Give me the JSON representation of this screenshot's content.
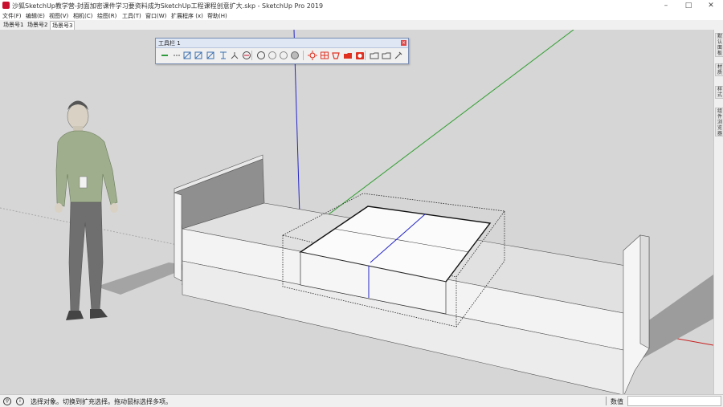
{
  "window": {
    "title": "沙狐SketchUp教学营-封面加密课件学习要资料成为SketchUp工程课程创意扩大.skp - SketchUp Pro 2019",
    "minimize_glyph": "–",
    "maximize_glyph": "□",
    "close_glyph": "✕"
  },
  "menu": [
    {
      "label": "文件(F)"
    },
    {
      "label": "编辑(E)"
    },
    {
      "label": "视图(V)"
    },
    {
      "label": "相机(C)"
    },
    {
      "label": "绘图(R)"
    },
    {
      "label": "工具(T)"
    },
    {
      "label": "窗口(W)"
    },
    {
      "label": "扩展程序 (x)"
    },
    {
      "label": "帮助(H)"
    }
  ],
  "scenes": [
    {
      "label": "场景号1",
      "active": false
    },
    {
      "label": "场景号2",
      "active": false
    },
    {
      "label": "场景号3",
      "active": true
    }
  ],
  "toolbar": {
    "title": "工具栏 1",
    "close_glyph": "×",
    "buttons": [
      {
        "icon": "select-icon",
        "color": "#2e9b3c"
      },
      {
        "icon": "dashes-icon",
        "color": "#555555"
      },
      {
        "icon": "iso-view-icon",
        "color": "#3a6fb0"
      },
      {
        "icon": "top-view-icon",
        "color": "#3a6fb0"
      },
      {
        "icon": "front-view-icon",
        "color": "#3a6fb0"
      },
      {
        "icon": "align-icon",
        "color": "#3a6fb0"
      },
      {
        "icon": "axes-icon",
        "color": "#555555"
      },
      {
        "icon": "section-icon",
        "color": "#c8102e"
      },
      {
        "icon": "xray-icon",
        "color": "#444444"
      },
      {
        "icon": "wireframe-icon",
        "color": "#888888"
      },
      {
        "icon": "hidden-line-icon",
        "color": "#888888"
      },
      {
        "icon": "shaded-icon",
        "color": "#666666"
      },
      {
        "icon": "sun-icon",
        "color": "#e03020"
      },
      {
        "icon": "grid-icon",
        "color": "#e03020"
      },
      {
        "icon": "component-icon",
        "color": "#e03020"
      },
      {
        "icon": "folder-red-icon",
        "color": "#e03020"
      },
      {
        "icon": "camera-icon",
        "color": "#e03020"
      },
      {
        "icon": "folder-icon",
        "color": "#555555"
      },
      {
        "icon": "open-folder-icon",
        "color": "#555555"
      },
      {
        "icon": "tools-icon",
        "color": "#555555"
      }
    ]
  },
  "trays": [
    {
      "label": "默认面板"
    },
    {
      "label": "材质"
    },
    {
      "label": "样式"
    },
    {
      "label": "组件浏览器"
    }
  ],
  "status": {
    "geo_icon": "geo-location-icon",
    "info_icon": "info-icon",
    "message": "选择对象。切换到扩充选择。拖动鼠标选择多项。",
    "measurements_label": "数值",
    "measurements_value": ""
  },
  "axes_colors": {
    "red": "#c81e1e",
    "green": "#2f9e2f",
    "blue": "#2626c8"
  },
  "background": "#d6d6d6"
}
